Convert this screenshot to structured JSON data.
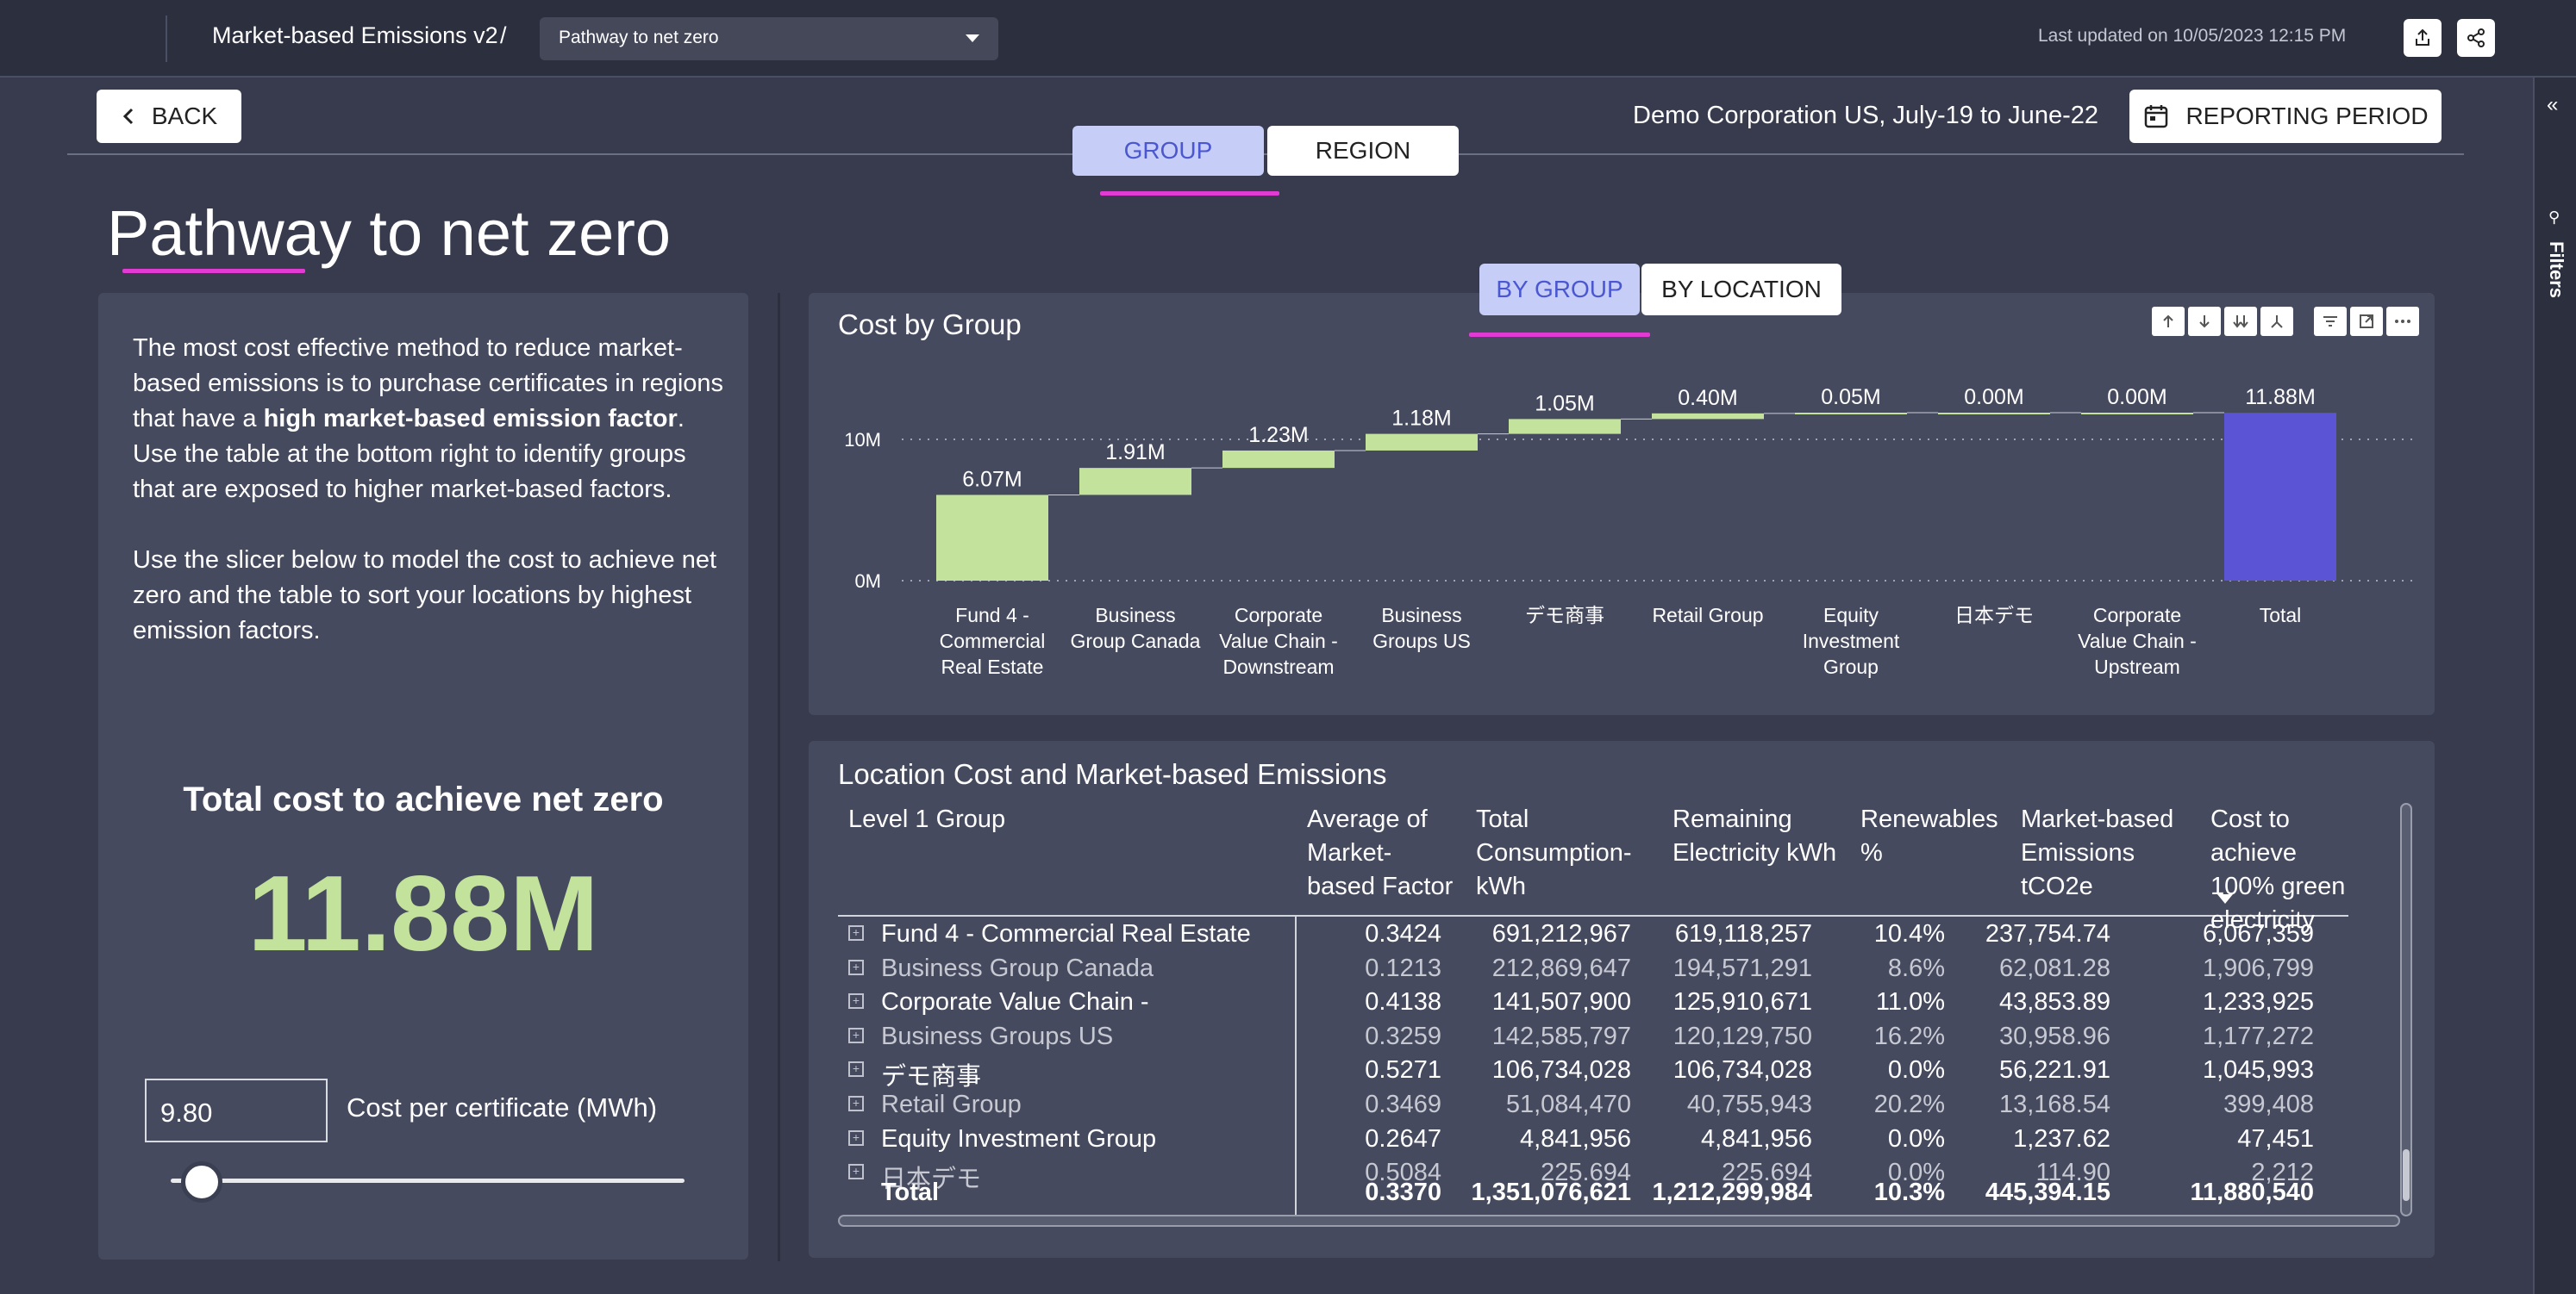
{
  "topbar": {
    "app_title": "Market-based Emissions v2",
    "separator": "/",
    "page_selector": "Pathway to net zero",
    "last_updated": "Last updated on 10/05/2023 12:15 PM",
    "icons": [
      "export-icon",
      "share-icon"
    ]
  },
  "header": {
    "back_label": "BACK",
    "company_period": "Demo Corporation US, July-19 to June-22",
    "reporting_label": "REPORTING PERIOD",
    "tabs": [
      {
        "label": "GROUP",
        "active": true
      },
      {
        "label": "REGION",
        "active": false
      }
    ],
    "page_title": "Pathway to net zero"
  },
  "filters_rail": {
    "label": "Filters"
  },
  "intro": {
    "p1_a": "The most cost effective method to reduce market-based emissions is to purchase certificates in regions that have a ",
    "p1_bold": "high market-based emission factor",
    "p1_b": ". Use the table at the bottom right to identify groups that are exposed to higher market-based factors.",
    "p2": "Use the slicer below to model the cost to achieve net zero and the table to sort your locations by highest emission factors."
  },
  "net_zero": {
    "title": "Total cost to achieve net zero",
    "value": "11.88M",
    "certificate_value": "9.80",
    "certificate_label": "Cost per certificate (MWh)",
    "slider_fraction": 0.06
  },
  "chart": {
    "title": "Cost by Group",
    "toggle": [
      {
        "label": "BY GROUP",
        "active": true
      },
      {
        "label": "BY LOCATION",
        "active": false
      }
    ]
  },
  "chart_data": {
    "type": "bar",
    "subtype": "waterfall",
    "title": "Cost by Group",
    "categories": [
      "Fund 4 - Commercial Real Estate",
      "Business Group Canada",
      "Corporate Value Chain - Downstream",
      "Business Groups US",
      "デモ商事",
      "Retail Group",
      "Equity Investment Group",
      "日本デモ",
      "Corporate Value Chain - Upstream",
      "Total"
    ],
    "category_lines": [
      [
        "Fund 4 -",
        "Commercial",
        "Real Estate"
      ],
      [
        "Business",
        "Group Canada"
      ],
      [
        "Corporate",
        "Value Chain -",
        "Downstream"
      ],
      [
        "Business",
        "Groups US"
      ],
      [
        "デモ商事"
      ],
      [
        "Retail Group"
      ],
      [
        "Equity",
        "Investment",
        "Group"
      ],
      [
        "日本デモ"
      ],
      [
        "Corporate",
        "Value Chain -",
        "Upstream"
      ],
      [
        "Total"
      ]
    ],
    "values": [
      6.07,
      1.91,
      1.23,
      1.18,
      1.05,
      0.4,
      0.05,
      0.0,
      0.0,
      11.88
    ],
    "value_labels": [
      "6.07M",
      "1.91M",
      "1.23M",
      "1.18M",
      "1.05M",
      "0.40M",
      "0.05M",
      "0.00M",
      "0.00M",
      "11.88M"
    ],
    "y_ticks": [
      "0M",
      "10M"
    ],
    "ylim": [
      0,
      12
    ],
    "unit": "M",
    "increase_color": "#c3e29c",
    "total_color": "#5b55d6",
    "grid": true,
    "legend": "none"
  },
  "table": {
    "title": "Location Cost and Market-based Emissions",
    "columns": [
      [
        "Level 1 Group"
      ],
      [
        "Average of",
        "Market-",
        "based Factor"
      ],
      [
        "Total",
        "Consumption-",
        "kWh"
      ],
      [
        "Remaining",
        "Electricity kWh"
      ],
      [
        "Renewables",
        "%"
      ],
      [
        "Market-based",
        "Emissions",
        "tCO2e"
      ],
      [
        "Cost to achieve",
        "100% green",
        "electricity"
      ]
    ],
    "rows": [
      {
        "name": "Fund 4 - Commercial Real Estate",
        "factor": "0.3424",
        "consumption": "691,212,967",
        "remaining": "619,118,257",
        "renew": "10.4%",
        "emissions": "237,754.74",
        "cost": "6,067,359",
        "bright": true
      },
      {
        "name": "Business Group Canada",
        "factor": "0.1213",
        "consumption": "212,869,647",
        "remaining": "194,571,291",
        "renew": "8.6%",
        "emissions": "62,081.28",
        "cost": "1,906,799",
        "bright": false
      },
      {
        "name": "Corporate Value Chain -",
        "factor": "0.4138",
        "consumption": "141,507,900",
        "remaining": "125,910,671",
        "renew": "11.0%",
        "emissions": "43,853.89",
        "cost": "1,233,925",
        "bright": true
      },
      {
        "name": "Business Groups US",
        "factor": "0.3259",
        "consumption": "142,585,797",
        "remaining": "120,129,750",
        "renew": "16.2%",
        "emissions": "30,958.96",
        "cost": "1,177,272",
        "bright": false
      },
      {
        "name": "デモ商事",
        "factor": "0.5271",
        "consumption": "106,734,028",
        "remaining": "106,734,028",
        "renew": "0.0%",
        "emissions": "56,221.91",
        "cost": "1,045,993",
        "bright": true
      },
      {
        "name": "Retail Group",
        "factor": "0.3469",
        "consumption": "51,084,470",
        "remaining": "40,755,943",
        "renew": "20.2%",
        "emissions": "13,168.54",
        "cost": "399,408",
        "bright": false
      },
      {
        "name": "Equity Investment Group",
        "factor": "0.2647",
        "consumption": "4,841,956",
        "remaining": "4,841,956",
        "renew": "0.0%",
        "emissions": "1,237.62",
        "cost": "47,451",
        "bright": true
      },
      {
        "name": "日本デモ",
        "factor": "0.5084",
        "consumption": "225.694",
        "remaining": "225.694",
        "renew": "0.0%",
        "emissions": "114.90",
        "cost": "2,212",
        "bright": false
      }
    ],
    "total": {
      "name": "Total",
      "factor": "0.3370",
      "consumption": "1,351,076,621",
      "remaining": "1,212,299,984",
      "renew": "10.3%",
      "emissions": "445,394.15",
      "cost": "11,880,540"
    }
  }
}
